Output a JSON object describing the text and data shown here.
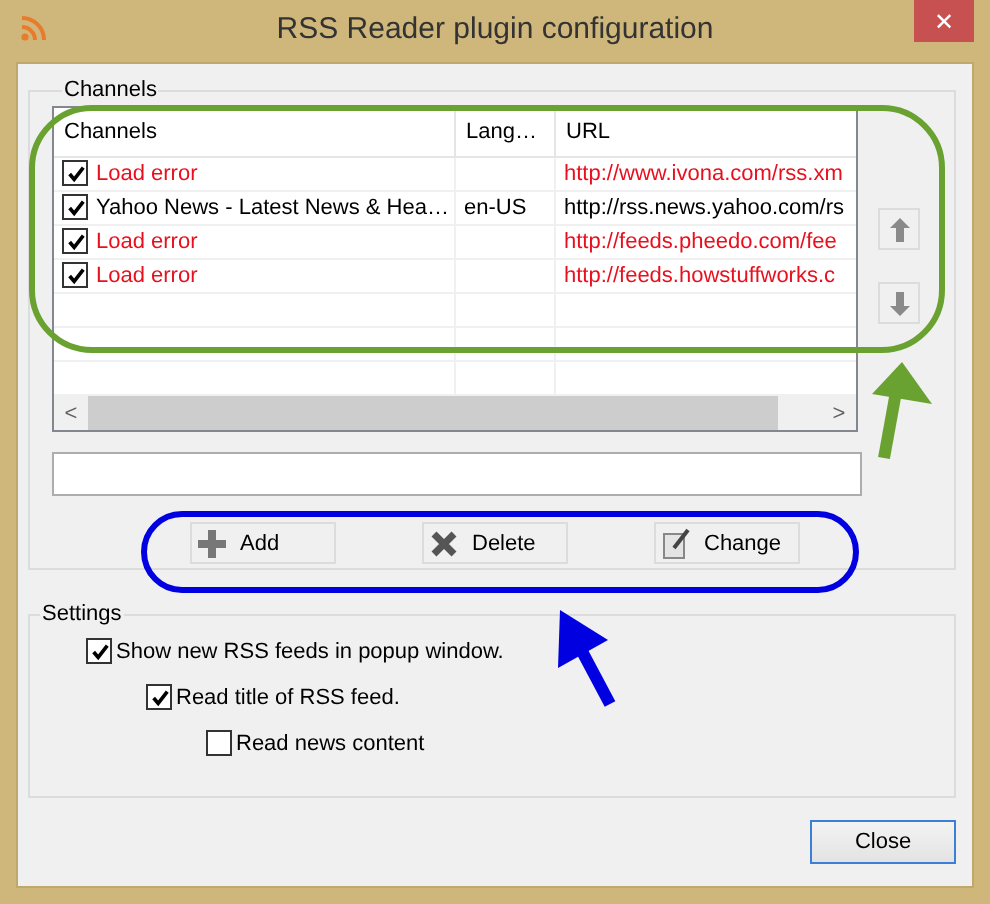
{
  "window": {
    "title": "RSS Reader plugin configuration",
    "close": "✕"
  },
  "channels": {
    "label": "Channels",
    "columns": [
      "Channels",
      "Lang…",
      "URL"
    ],
    "rows": [
      {
        "checked": true,
        "error": true,
        "name": "Load error",
        "url": "http://www.ivona.com/rss.xm"
      },
      {
        "checked": true,
        "error": false,
        "name": "Yahoo News - Latest News & Hea…",
        "language": "en-US",
        "url": "http://rss.news.yahoo.com/rs"
      },
      {
        "checked": true,
        "error": true,
        "name": "Load error",
        "url": "http://feeds.pheedo.com/fee"
      },
      {
        "checked": true,
        "error": true,
        "name": "Load error",
        "url": "http://feeds.howstuffworks.c"
      }
    ],
    "scroll_left": "<",
    "scroll_right": ">",
    "buttons": [
      {
        "kind": "add",
        "label": "Add"
      },
      {
        "kind": "delete",
        "label": "Delete"
      },
      {
        "kind": "change",
        "label": "Change"
      }
    ]
  },
  "settings": {
    "label": "Settings",
    "options": [
      {
        "label": "Show new RSS feeds in popup window.",
        "checked": true,
        "children": [
          {
            "label": "Read title of RSS feed.",
            "checked": true,
            "children": [
              {
                "label": "Read news content",
                "checked": false
              }
            ]
          }
        ]
      }
    ]
  },
  "buttons": [
    "Close"
  ]
}
